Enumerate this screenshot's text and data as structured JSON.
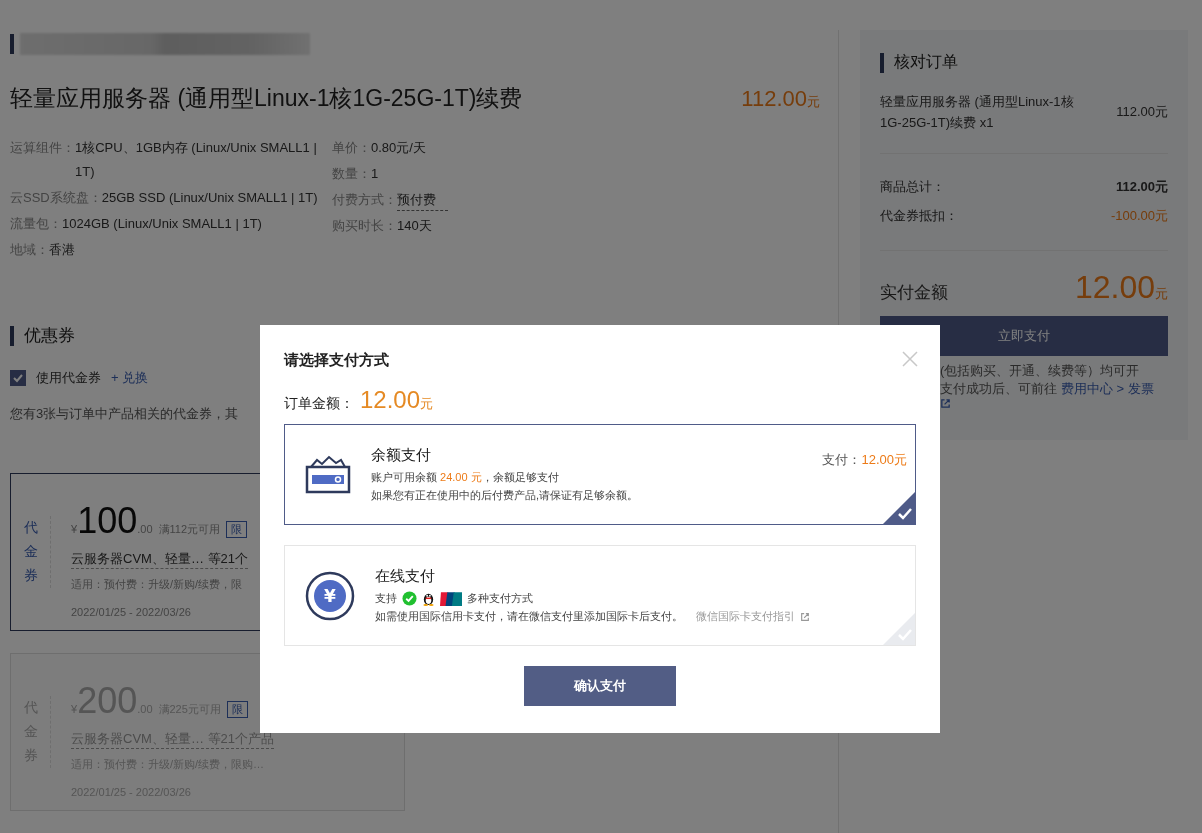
{
  "product": {
    "title": "轻量应用服务器 (通用型Linux-1核1G-25G-1T)续费",
    "price": "112.00",
    "unit": "元",
    "specs_left": [
      {
        "label": "运算组件：",
        "value": "1核CPU、1GB内存 (Linux/Unix SMALL1 | 1T)"
      },
      {
        "label": "云SSD系统盘：",
        "value": "25GB SSD (Linux/Unix SMALL1 | 1T)"
      },
      {
        "label": "流量包：",
        "value": "1024GB (Linux/Unix SMALL1 | 1T)"
      },
      {
        "label": "地域：",
        "value": "香港"
      }
    ],
    "specs_right": [
      {
        "label": "单价：",
        "value": "0.80元/天",
        "dotted": false
      },
      {
        "label": "数量：",
        "value": "1",
        "dotted": false
      },
      {
        "label": "付费方式：",
        "value": "预付费",
        "dotted": true
      },
      {
        "label": "购买时长：",
        "value": "140天",
        "dotted": false
      }
    ]
  },
  "coupons": {
    "title": "优惠券",
    "use_voucher": {
      "label": "使用代金券",
      "checked": true
    },
    "exchange_link": "+ 兑换",
    "note": "您有3张与订单中产品相关的代金券，其",
    "items": [
      {
        "type_label": "代金券",
        "symbol": "¥",
        "amount": "100",
        "decimals": ".00",
        "condition": "满112元可用",
        "tag": "限",
        "products": "云服务器CVM、轻量… 等21个",
        "usage": "适用：预付费：升级/新购/续费，限",
        "validity": "2022/01/25 - 2022/03/26",
        "selected": true
      },
      {
        "type_label": "代金券",
        "symbol": "¥",
        "amount": "200",
        "decimals": ".00",
        "condition": "满225元可用",
        "tag": "限",
        "products": "云服务器CVM、轻量… 等21个产品",
        "usage": "适用：预付费：升级/新购/续费，限购…",
        "validity": "2022/01/25 - 2022/03/26",
        "selected": false
      }
    ]
  },
  "order_summary": {
    "title": "核对订单",
    "item": {
      "name": "轻量应用服务器 (通用型Linux-1核1G-25G-1T)续费 x1",
      "price": "112.00元"
    },
    "subtotal": {
      "label": "商品总计：",
      "value": "112.00元"
    },
    "discount": {
      "label": "代金券抵扣：",
      "value": "-100.00元"
    },
    "total": {
      "label": "实付金额",
      "amount": "12.00",
      "unit": "元"
    },
    "pay_button": "立即支付",
    "note_line_1": "(包括购买、开通、续费等）均可开",
    "note_line_2": "支付成功后、可前往",
    "note_link": "费用中心 > 发票"
  },
  "modal": {
    "title": "请选择支付方式",
    "amount_label": "订单金额：",
    "amount": "12.00",
    "unit": "元",
    "methods": [
      {
        "kind": "balance",
        "name": "余额支付",
        "pay_label": "支付：",
        "pay_amount": "12.00元",
        "balance_prefix": "账户可用余额",
        "balance": "24.00 元",
        "balance_suffix": "，余额足够支付",
        "hint": "如果您有正在使用中的后付费产品,请保证有足够余额。",
        "selected": true
      },
      {
        "kind": "online",
        "name": "在线支付",
        "coin_glyph": "¥",
        "support_label": "支持",
        "support_suffix": "多种支付方式",
        "hint": "如需使用国际信用卡支付，请在微信支付里添加国际卡后支付。",
        "guide_link": "微信国际卡支付指引",
        "selected": false
      }
    ],
    "confirm_button": "确认支付"
  }
}
